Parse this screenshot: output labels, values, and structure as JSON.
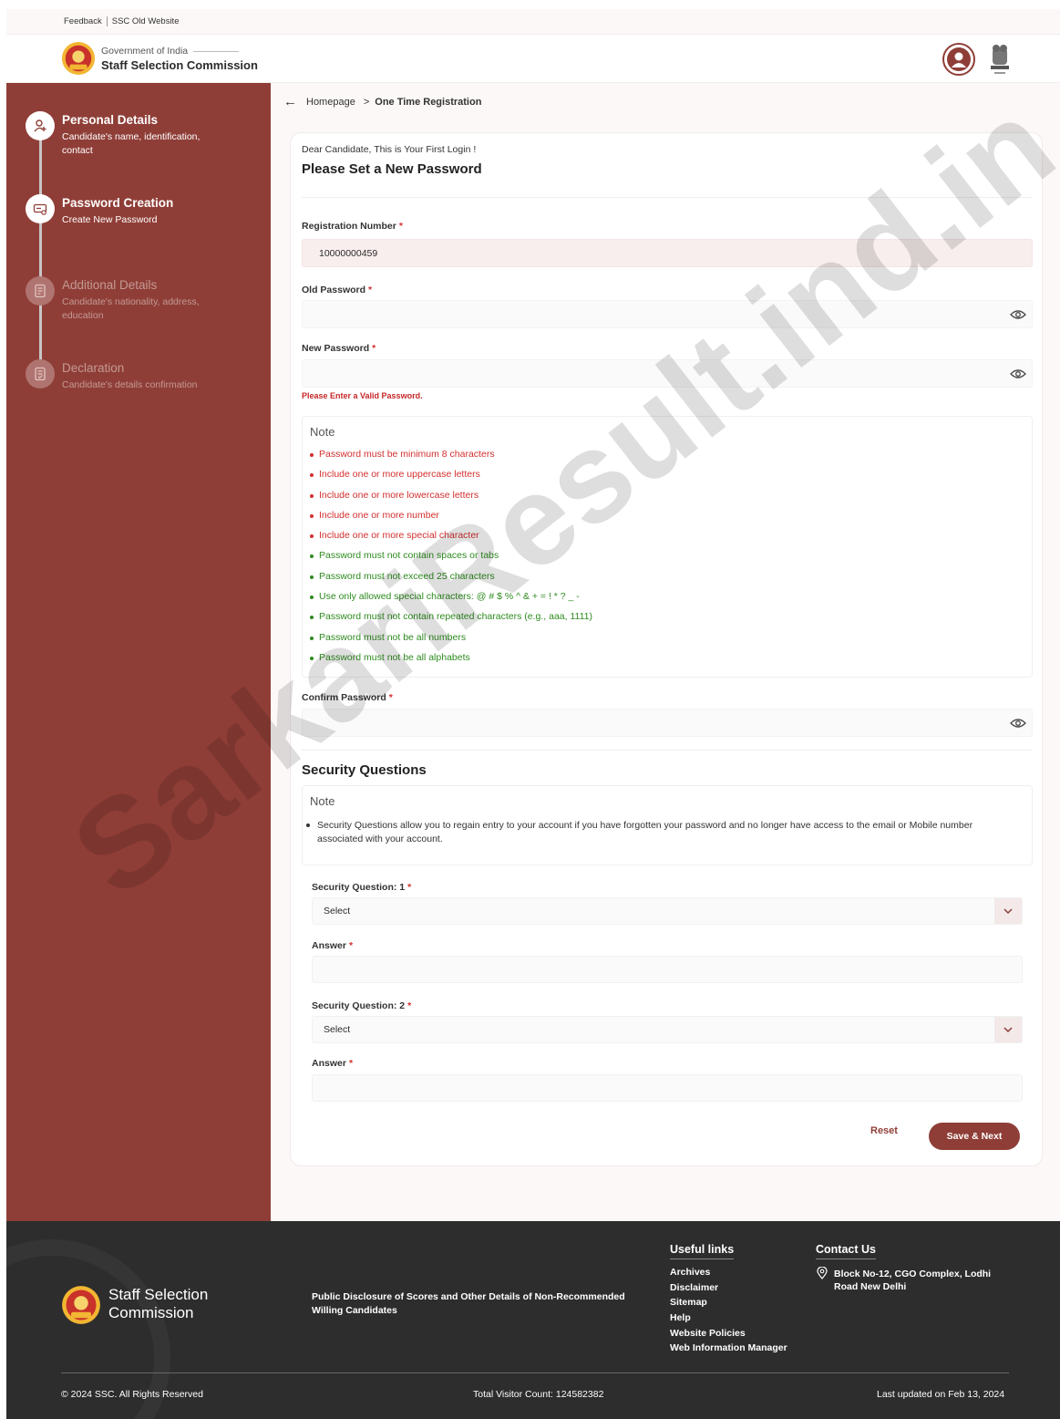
{
  "topbar": {
    "feedback": "Feedback",
    "old_site": "SSC Old Website"
  },
  "header": {
    "gov": "Government of India",
    "org": "Staff Selection Commission"
  },
  "sidebar": {
    "steps": [
      {
        "title": "Personal Details",
        "desc": "Candidate's name, identification, contact",
        "state": "completed"
      },
      {
        "title": "Password Creation",
        "desc": "Create New Password",
        "state": "active"
      },
      {
        "title": "Additional Details",
        "desc": "Candidate's nationality, address, education",
        "state": "pending"
      },
      {
        "title": "Declaration",
        "desc": "Candidate's details confirmation",
        "state": "pending"
      }
    ]
  },
  "breadcrumb": {
    "home": "Homepage",
    "sep": ">",
    "current": "One Time Registration"
  },
  "form": {
    "greeting": "Dear Candidate, This is Your First Login !",
    "heading": "Please Set a New Password",
    "reg_label": "Registration Number",
    "reg_value": "10000000459",
    "old_label": "Old Password",
    "new_label": "New Password",
    "error": "Please Enter a Valid Password.",
    "note_title": "Note",
    "rules": [
      {
        "text": "Password must be minimum 8 characters",
        "ok": false
      },
      {
        "text": "Include one or more uppercase letters",
        "ok": false
      },
      {
        "text": "Include one or more lowercase letters",
        "ok": false
      },
      {
        "text": "Include one or more number",
        "ok": false
      },
      {
        "text": "Include one or more special character",
        "ok": false
      },
      {
        "text": "Password must not contain spaces or tabs",
        "ok": true
      },
      {
        "text": "Password must not exceed 25 characters",
        "ok": true
      },
      {
        "text": "Use only allowed special characters: @ # $ % ^ & + = ! * ? _ -",
        "ok": true
      },
      {
        "text": "Password must not contain repeated characters (e.g., aaa, 1111)",
        "ok": true
      },
      {
        "text": "Password must not be all numbers",
        "ok": true
      },
      {
        "text": "Password must not be all alphabets",
        "ok": true
      }
    ],
    "confirm_label": "Confirm Password",
    "required_mark": "*"
  },
  "security": {
    "title": "Security Questions",
    "note_title": "Note",
    "note_text": "Security Questions allow you to regain entry to your account if you have forgotten your password and no longer have access to the email or Mobile number associated with your account.",
    "q1_label": "Security Question: 1",
    "q2_label": "Security Question: 2",
    "select_value": "Select",
    "answer_label": "Answer"
  },
  "buttons": {
    "reset": "Reset",
    "save": "Save & Next"
  },
  "footer": {
    "org_name": "Staff Selection Commission",
    "disclosure": "Public Disclosure of Scores and Other Details of Non-Recommended Willing Candidates",
    "useful_title": "Useful links",
    "useful_links": [
      "Archives",
      "Disclaimer",
      "Sitemap",
      "Help",
      "Website Policies",
      "Web Information Manager"
    ],
    "contact_title": "Contact Us",
    "address": "Block No-12, CGO Complex, Lodhi Road New Delhi",
    "copyright": "© 2024 SSC. All Rights Reserved",
    "visitors": "Total Visitor Count: 124582382",
    "updated": "Last updated on Feb 13, 2024"
  },
  "watermark": "SarkariResult.ind.in",
  "colors": {
    "brand": "#8f3e37",
    "error": "#d32f2f",
    "ok": "#2e8b1f"
  }
}
